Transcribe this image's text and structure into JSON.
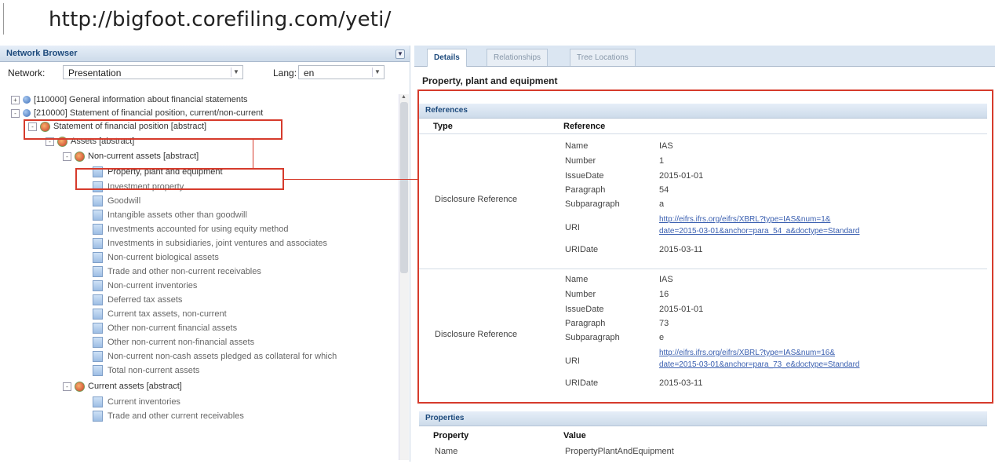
{
  "url": "http://bigfoot.corefiling.com/yeti/",
  "left": {
    "panel_title": "Network Browser",
    "network_label": "Network:",
    "network_value": "Presentation",
    "lang_label": "Lang:",
    "lang_value": "en",
    "tree": [
      "[110000] General information about financial statements",
      "[210000] Statement of financial position, current/non-current",
      "Statement of financial position [abstract]",
      "Assets [abstract]",
      "Non-current assets [abstract]",
      "Property, plant and equipment",
      "Investment property",
      "Goodwill",
      "Intangible assets other than goodwill",
      "Investments accounted for using equity method",
      "Investments in subsidiaries, joint ventures and associates",
      "Non-current biological assets",
      "Trade and other non-current receivables",
      "Non-current inventories",
      "Deferred tax assets",
      "Current tax assets, non-current",
      "Other non-current financial assets",
      "Other non-current non-financial assets",
      "Non-current non-cash assets pledged as collateral for which",
      "Total non-current assets",
      "Current assets [abstract]",
      "Current inventories",
      "Trade and other current receivables"
    ]
  },
  "right": {
    "tabs": [
      "Details",
      "Relationships",
      "Tree Locations"
    ],
    "concept_title": "Property, plant and equipment",
    "references": {
      "section_title": "References",
      "col_type": "Type",
      "col_reference": "Reference",
      "rows": [
        {
          "type": "Disclosure Reference",
          "fields": [
            {
              "k": "Name",
              "v": "IAS"
            },
            {
              "k": "Number",
              "v": "1"
            },
            {
              "k": "IssueDate",
              "v": "2015-01-01"
            },
            {
              "k": "Paragraph",
              "v": "54"
            },
            {
              "k": "Subparagraph",
              "v": "a"
            },
            {
              "k": "URI",
              "v1": "http://eifrs.ifrs.org/eifrs/XBRL?type=IAS&num=1&",
              "v2": "date=2015-03-01&anchor=para_54_a&doctype=Standard"
            },
            {
              "k": "URIDate",
              "v": "2015-03-11"
            }
          ]
        },
        {
          "type": "Disclosure Reference",
          "fields": [
            {
              "k": "Name",
              "v": "IAS"
            },
            {
              "k": "Number",
              "v": "16"
            },
            {
              "k": "IssueDate",
              "v": "2015-01-01"
            },
            {
              "k": "Paragraph",
              "v": "73"
            },
            {
              "k": "Subparagraph",
              "v": "e"
            },
            {
              "k": "URI",
              "v1": "http://eifrs.ifrs.org/eifrs/XBRL?type=IAS&num=16&",
              "v2": "date=2015-03-01&anchor=para_73_e&doctype=Standard"
            },
            {
              "k": "URIDate",
              "v": "2015-03-11"
            }
          ]
        }
      ]
    },
    "properties": {
      "section_title": "Properties",
      "col_property": "Property",
      "col_value": "Value",
      "row_name_key": "Name",
      "row_name_value": "PropertyPlantAndEquipment"
    }
  },
  "colors": {
    "highlight": "#d63b2c",
    "accent": "#1d4a7c"
  }
}
